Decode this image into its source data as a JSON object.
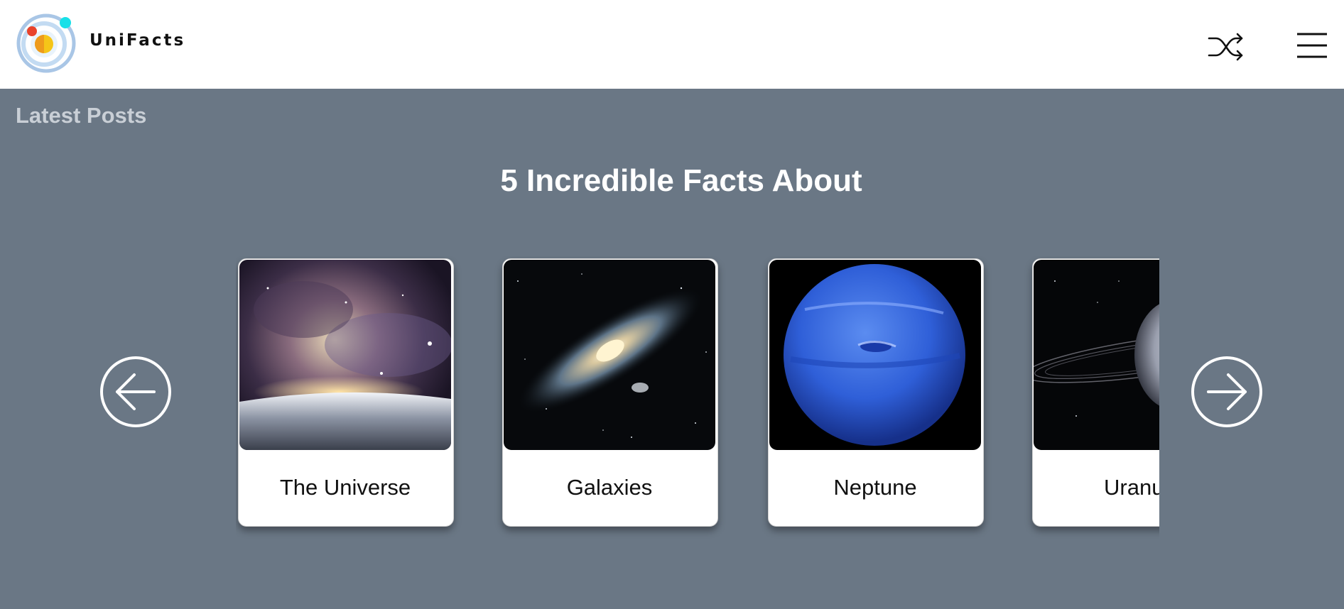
{
  "header": {
    "brand": "UniFacts",
    "icons": [
      "logo-icon",
      "shuffle-icon",
      "hamburger-menu-icon"
    ]
  },
  "section": {
    "label": "Latest Posts"
  },
  "carousel": {
    "headline": "5 Incredible Facts About",
    "prev_icon": "arrow-left-circle-icon",
    "next_icon": "arrow-right-circle-icon",
    "cards": [
      {
        "title": "The Universe",
        "image": "nebula-over-planet-image"
      },
      {
        "title": "Galaxies",
        "image": "spiral-galaxy-image"
      },
      {
        "title": "Neptune",
        "image": "neptune-planet-image"
      },
      {
        "title": "Uranus",
        "image": "uranus-rings-image"
      }
    ]
  },
  "colors": {
    "header_bg": "#ffffff",
    "page_bg": "#6a7785",
    "label_color": "#c9cfd6",
    "headline_color": "#ffffff"
  }
}
